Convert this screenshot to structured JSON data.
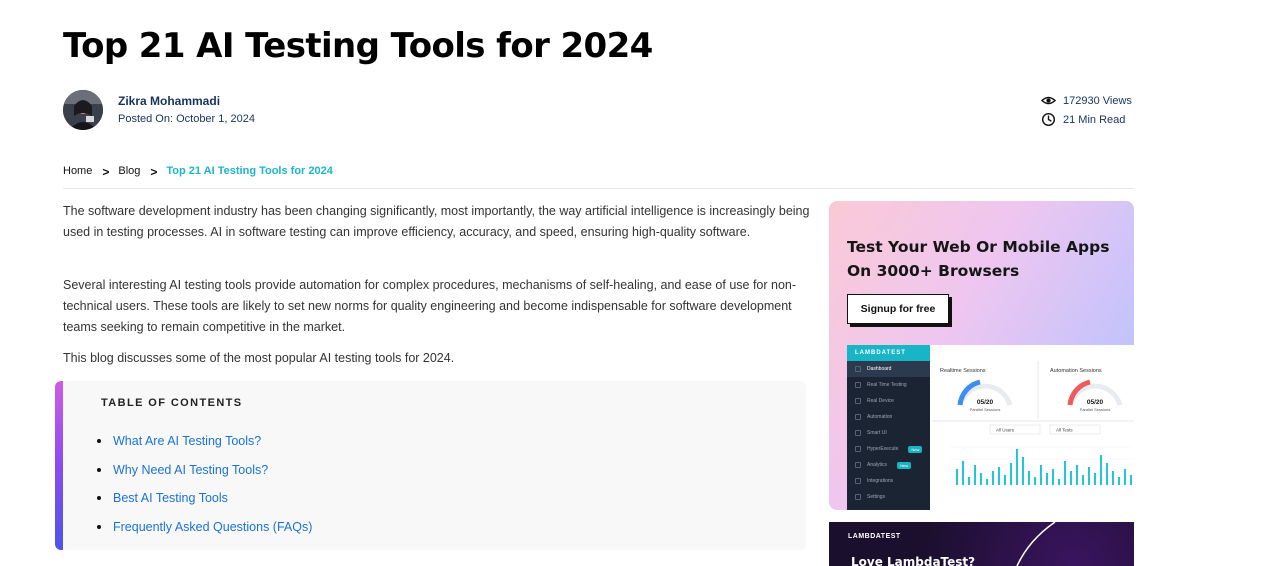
{
  "article": {
    "title": "Top 21 AI Testing Tools for 2024",
    "author": "Zikra Mohammadi",
    "posted": "Posted On: October 1, 2024",
    "views": "172930 Views",
    "read_time": "21 Min Read"
  },
  "breadcrumb": {
    "home": "Home",
    "blog": "Blog",
    "current": "Top 21 AI Testing Tools for 2024",
    "separator": ">"
  },
  "body": {
    "paragraphs": [
      "The software development industry has been changing significantly, most importantly, the way artificial intelligence is increasingly being used in testing processes. AI in software testing can improve efficiency, accuracy, and speed, ensuring high-quality software.",
      "Several interesting AI testing tools provide automation for complex procedures, mechanisms of self-healing, and ease of use for non-technical users. These tools are likely to set new norms for quality engineering and become indispensable for software development teams seeking to remain competitive in the market.",
      "This blog discusses some of the most popular AI testing tools for 2024."
    ]
  },
  "toc": {
    "title": "TABLE OF CONTENTS",
    "items": [
      "What Are AI Testing Tools?",
      "Why Need AI Testing Tools?",
      "Best AI Testing Tools",
      "Frequently Asked Questions (FAQs)"
    ]
  },
  "ad": {
    "headline": "Test Your Web Or Mobile Apps On 3000+ Browsers",
    "cta": "Signup for free",
    "dashboard": {
      "brand": "LAMBDATEST",
      "nav": [
        "Dashboard",
        "Real Time Testing",
        "Real Device",
        "Automation",
        "Smart UI",
        "HyperExecute",
        "Analytics",
        "Integrations",
        "Settings"
      ],
      "nav_badge": "New",
      "panel1_title": "Realtime Sessions",
      "panel1_value": "05/20",
      "panel2_title": "Automation Sessions",
      "panel2_value": "05/20",
      "gauge_caption": "Parallel Sessions",
      "filter1": "All Users",
      "filter2": "All Tests"
    }
  },
  "ad2": {
    "brand": "LAMBDATEST",
    "text": "Love LambdaTest?"
  },
  "colors": {
    "accent": "#1bb6c8",
    "link": "#1a72d8",
    "author": "#16345a"
  }
}
